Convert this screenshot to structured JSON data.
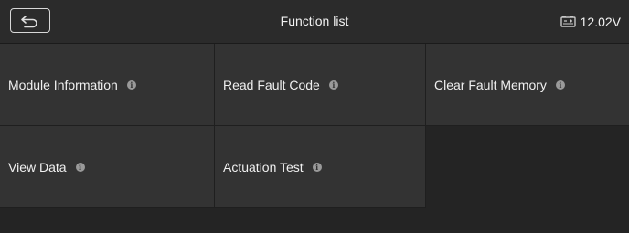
{
  "header": {
    "title": "Function list",
    "voltage": "12.02V"
  },
  "functions": [
    {
      "label": "Module Information",
      "info_glyph": "i"
    },
    {
      "label": "Read Fault Code",
      "info_glyph": "i"
    },
    {
      "label": "Clear Fault Memory",
      "info_glyph": "i"
    },
    {
      "label": "View Data",
      "info_glyph": "i"
    },
    {
      "label": "Actuation Test",
      "info_glyph": "i"
    }
  ],
  "icons": {
    "back": "back-arrow-icon",
    "battery": "battery-icon",
    "info": "info-icon"
  },
  "colors": {
    "background": "#242424",
    "header": "#2b2b2b",
    "tile": "#333333",
    "text": "#f0f0f0"
  }
}
